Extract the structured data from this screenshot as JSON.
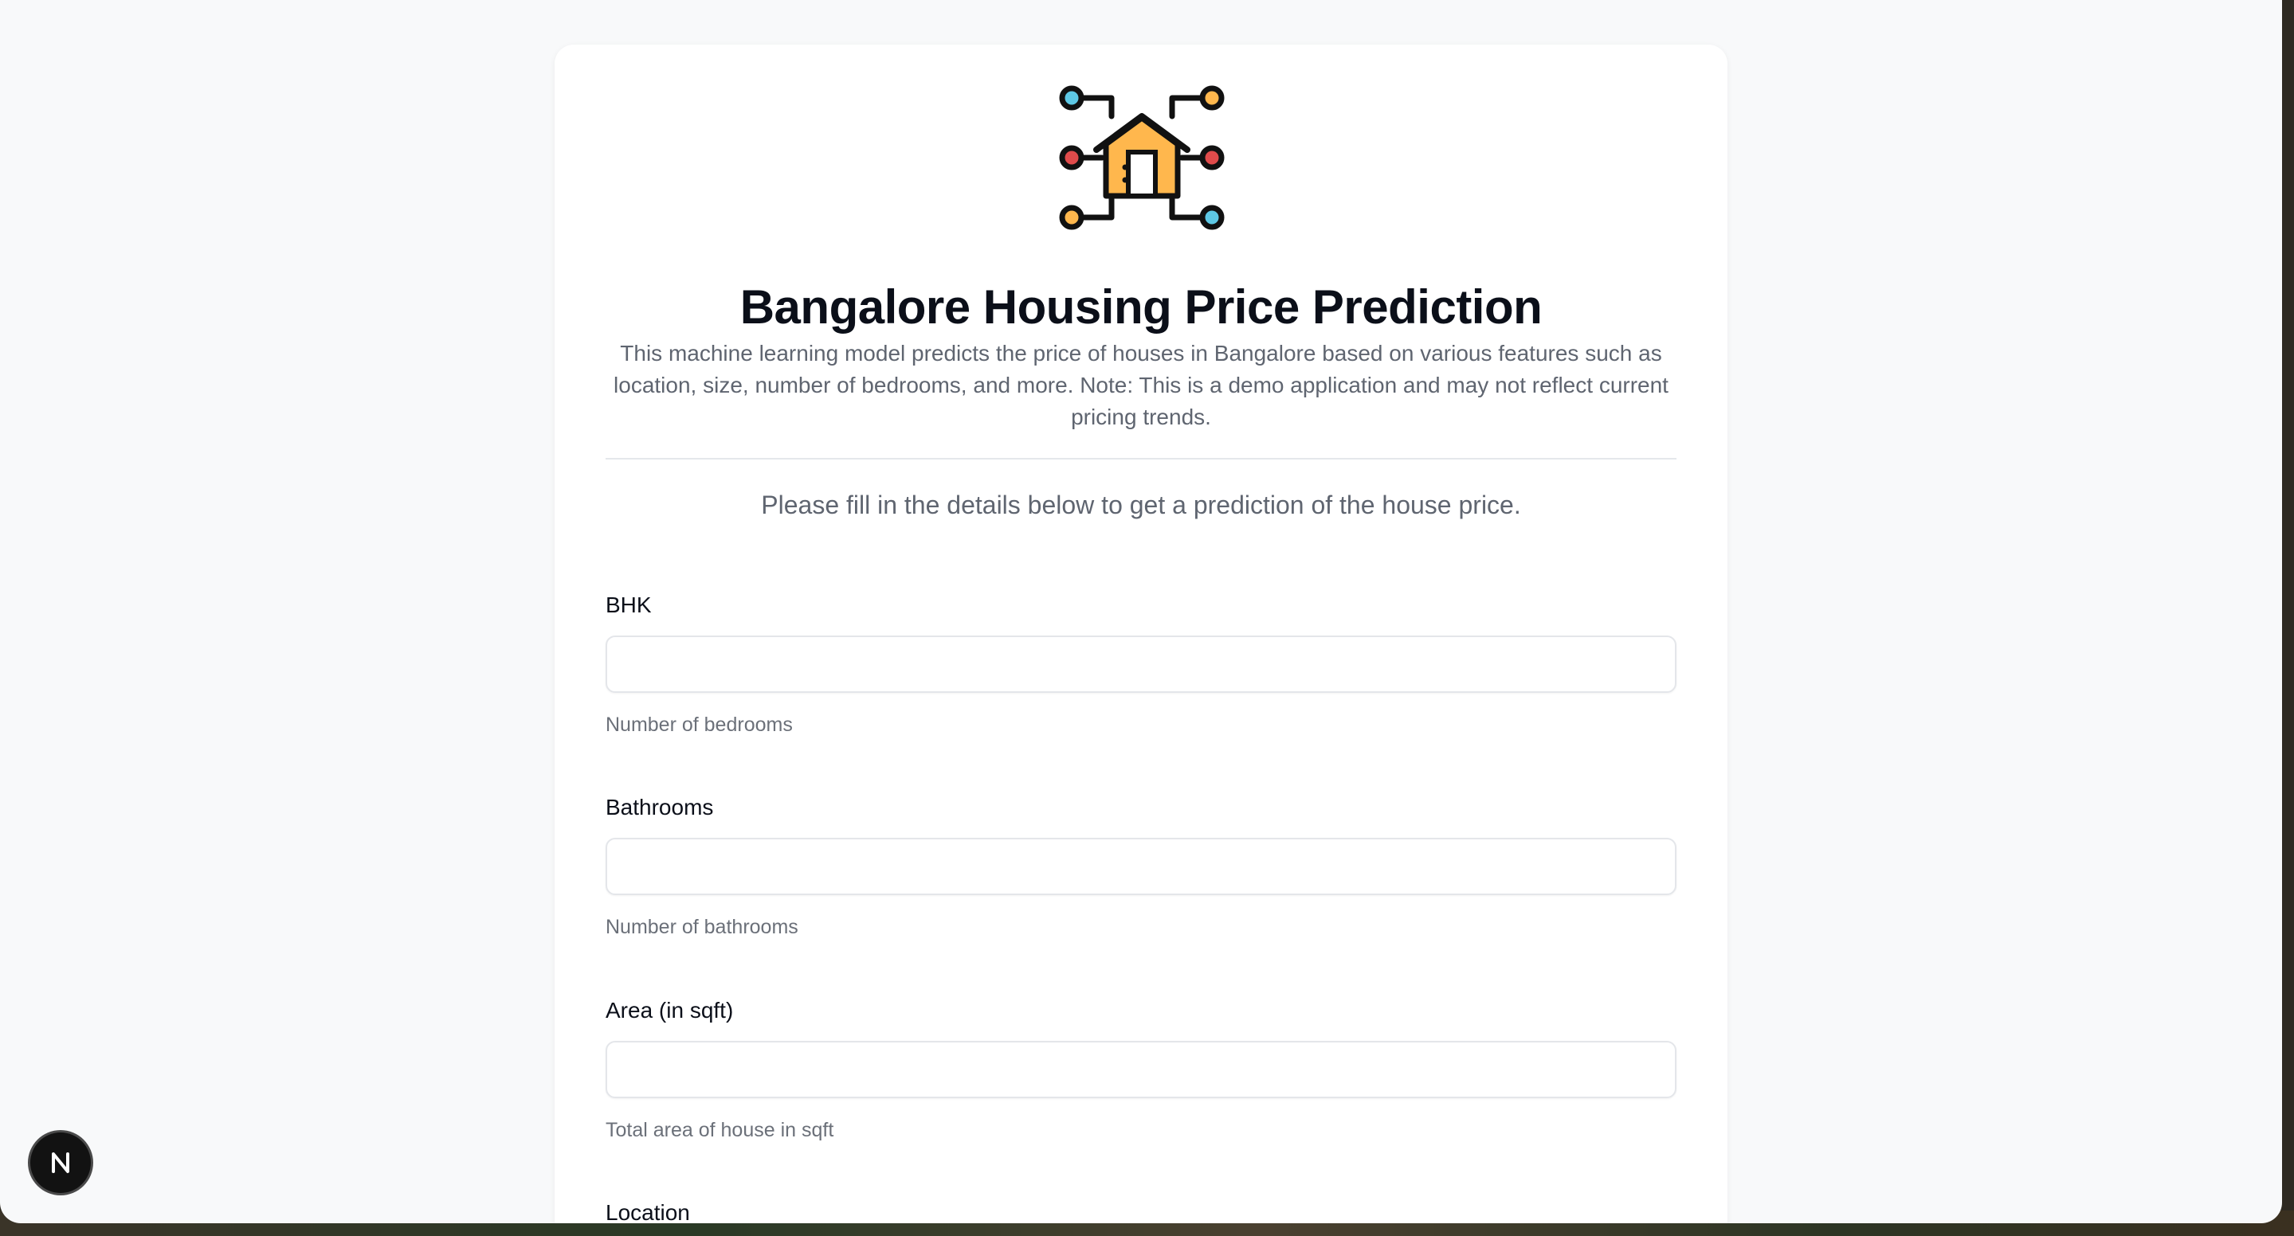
{
  "app": {
    "title": "Bangalore Housing Price Prediction",
    "description": "This machine learning model predicts the price of houses in Bangalore based on various features such as location, size, number of bedrooms, and more. Note: This is a demo application and may not reflect current pricing trends.",
    "instructions": "Please fill in the details below to get a prediction of the house price."
  },
  "form": {
    "bhk": {
      "label": "BHK",
      "value": "",
      "help": "Number of bedrooms"
    },
    "bathrooms": {
      "label": "Bathrooms",
      "value": "",
      "help": "Number of bathrooms"
    },
    "area": {
      "label": "Area (in sqft)",
      "value": "",
      "help": "Total area of house in sqft"
    },
    "location": {
      "label": "Location"
    }
  },
  "icons": {
    "logo": "house-network-icon",
    "dev_badge": "nextjs-icon"
  },
  "colors": {
    "house_fill": "#ffb74d",
    "node_blue": "#5ec8e5",
    "node_red": "#e04b4b",
    "node_orange": "#ffb74d",
    "title": "#0b0f19",
    "muted": "#5f6570"
  }
}
